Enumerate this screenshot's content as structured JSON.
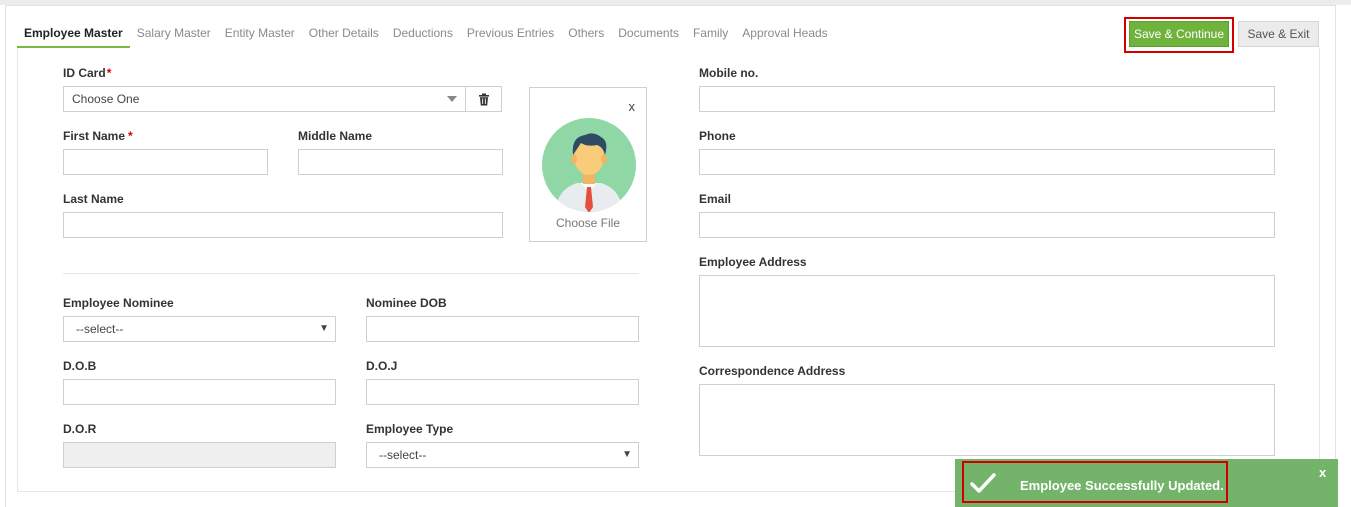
{
  "tabs": [
    {
      "label": "Employee Master",
      "active": true
    },
    {
      "label": "Salary Master",
      "active": false
    },
    {
      "label": "Entity Master",
      "active": false
    },
    {
      "label": "Other Details",
      "active": false
    },
    {
      "label": "Deductions",
      "active": false
    },
    {
      "label": "Previous Entries",
      "active": false
    },
    {
      "label": "Others",
      "active": false
    },
    {
      "label": "Documents",
      "active": false
    },
    {
      "label": "Family",
      "active": false
    },
    {
      "label": "Approval Heads",
      "active": false
    }
  ],
  "actions": {
    "save_continue": "Save & Continue",
    "save_exit": "Save & Exit"
  },
  "form": {
    "id_card": {
      "label": "ID Card",
      "required_mark": "*",
      "value": "Choose One"
    },
    "first_name": {
      "label": "First Name",
      "required_mark": "*"
    },
    "middle_name": {
      "label": "Middle Name"
    },
    "last_name": {
      "label": "Last Name"
    },
    "photo": {
      "close": "x",
      "choose_file": "Choose File"
    },
    "employee_nominee": {
      "label": "Employee Nominee",
      "value": "--select--"
    },
    "nominee_dob": {
      "label": "Nominee DOB"
    },
    "dob": {
      "label": "D.O.B"
    },
    "doj": {
      "label": "D.O.J"
    },
    "dor": {
      "label": "D.O.R"
    },
    "employee_type": {
      "label": "Employee Type",
      "value": "--select--"
    },
    "mobile": {
      "label": "Mobile no."
    },
    "phone": {
      "label": "Phone"
    },
    "email": {
      "label": "Email"
    },
    "employee_address": {
      "label": "Employee Address"
    },
    "correspondence_address": {
      "label": "Correspondence Address"
    }
  },
  "toast": {
    "message": "Employee Successfully Updated.",
    "close": "x"
  },
  "colors": {
    "accent_green": "#6fb33d",
    "toast_green": "#74b36a",
    "highlight_red": "#d20000",
    "required_red": "#d00000"
  },
  "icons": {
    "trash": "trash-icon",
    "avatar": "avatar-icon",
    "check": "check-icon",
    "caret": "caret-down-icon"
  }
}
